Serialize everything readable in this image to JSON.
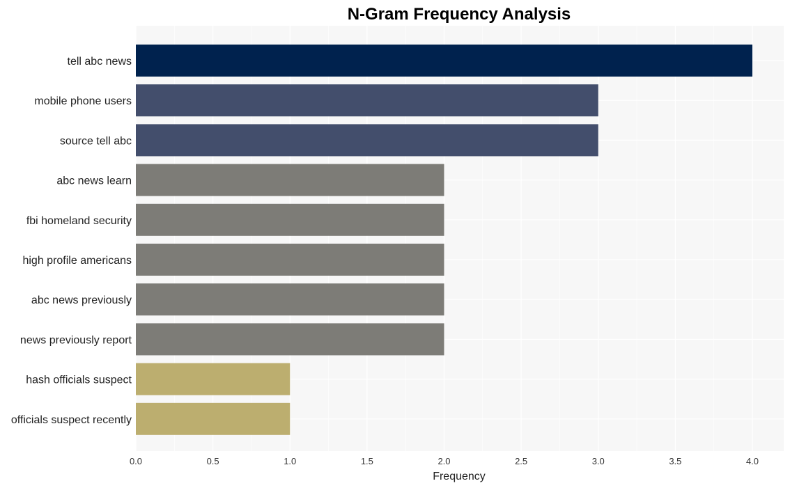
{
  "chart_data": {
    "type": "bar",
    "orientation": "horizontal",
    "title": "N-Gram Frequency Analysis",
    "xlabel": "Frequency",
    "ylabel": "",
    "xlim": [
      0,
      4.2
    ],
    "xticks": [
      0.0,
      0.5,
      1.0,
      1.5,
      2.0,
      2.5,
      3.0,
      3.5,
      4.0
    ],
    "xtick_labels": [
      "0.0",
      "0.5",
      "1.0",
      "1.5",
      "2.0",
      "2.5",
      "3.0",
      "3.5",
      "4.0"
    ],
    "grid": true,
    "categories": [
      "tell abc news",
      "mobile phone users",
      "source tell abc",
      "abc news learn",
      "fbi homeland security",
      "high profile americans",
      "abc news previously",
      "news previously report",
      "hash officials suspect",
      "officials suspect recently"
    ],
    "values": [
      4,
      3,
      3,
      2,
      2,
      2,
      2,
      2,
      1,
      1
    ],
    "colors": {
      "4": "#00224e",
      "3": "#434e6c",
      "2": "#7d7c77",
      "1": "#bcae6f"
    },
    "background": "#f7f7f7",
    "gridline_color": "#ffffff"
  }
}
